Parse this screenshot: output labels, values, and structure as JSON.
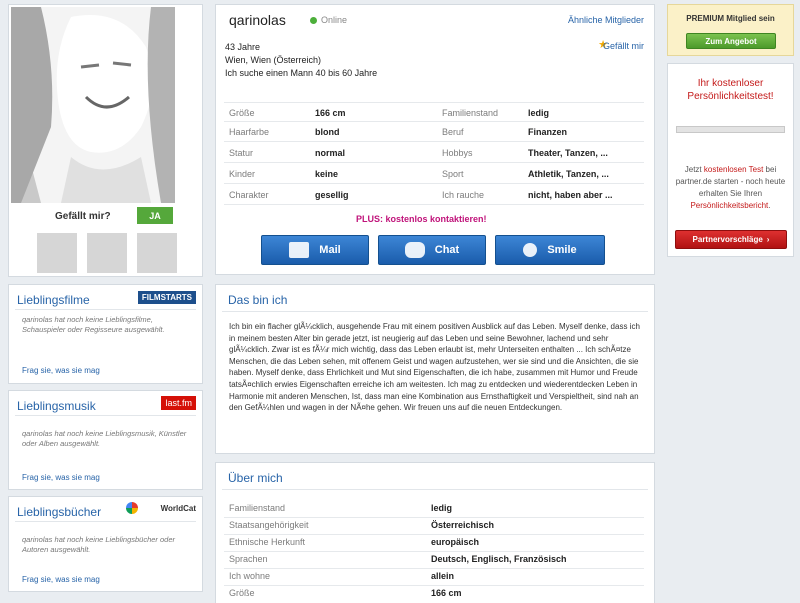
{
  "profile": {
    "username": "qarinolas",
    "status": "Online",
    "similar_link": "Ähnliche Mitglieder",
    "like_link": "Gefällt mir",
    "age": "43 Jahre",
    "location": "Wien, Wien (Österreich)",
    "search": "Ich suche einen Mann 40 bis 60 Jahre",
    "like_question": "Gefällt mir?",
    "like_button": "JA",
    "plus_text": "PLUS: kostenlos kontaktieren!",
    "mail_label": "Mail",
    "chat_label": "Chat",
    "smile_label": "Smile"
  },
  "attributes": [
    {
      "label": "Größe",
      "value": "166 cm",
      "label2": "Familienstand",
      "value2": "ledig"
    },
    {
      "label": "Haarfarbe",
      "value": "blond",
      "label2": "Beruf",
      "value2": "Finanzen"
    },
    {
      "label": "Statur",
      "value": "normal",
      "label2": "Hobbys",
      "value2": "Theater, Tanzen, ..."
    },
    {
      "label": "Kinder",
      "value": "keine",
      "label2": "Sport",
      "value2": "Athletik, Tanzen, ..."
    },
    {
      "label": "Charakter",
      "value": "gesellig",
      "label2": "Ich rauche",
      "value2": "nicht, haben aber ..."
    }
  ],
  "sidebar": {
    "films": {
      "title": "Lieblingsfilme",
      "badge": "FILMSTARTS",
      "text": "qarinolas hat noch keine Lieblingsfilme, Schauspieler oder Regisseure ausgewählt.",
      "link": "Frag sie, was sie mag"
    },
    "music": {
      "title": "Lieblingsmusik",
      "badge": "last.fm",
      "text": "qarinolas hat noch keine Lieblingsmusik, Künstler oder Alben ausgewählt.",
      "link": "Frag sie, was sie mag"
    },
    "books": {
      "title": "Lieblingsbücher",
      "badge": "WorldCat",
      "text": "qarinolas hat noch keine Lieblingsbücher oder Autoren ausgewählt.",
      "link": "Frag sie, was sie mag"
    }
  },
  "about": {
    "title": "Das bin ich",
    "text": "Ich bin ein flacher glÃ¼cklich, ausgehende Frau mit einem positiven Ausblick auf das Leben. Myself denke, dass ich in meinem besten Alter bin gerade jetzt, ist neugierig auf das Leben und seine Bewohner, lachend und sehr glÃ¼cklich. Zwar ist es fÃ¼r mich wichtig, dass das Leben erlaubt ist, mehr Unterseiten enthalten ... Ich schÃ¤tze Menschen, die das Leben sehen, mit offenem Geist und wagen aufzustehen, wer sie sind und die Ansichten, die sie haben. Myself denke, dass Ehrlichkeit und Mut sind Eigenschaften, die ich habe, zusammen mit Humor und Freude tatsÃ¤chlich erwies Eigenschaften erreiche ich am weitesten. Ich mag zu entdecken und wiederentdecken Leben in Harmonie mit anderen Menschen, Ist, dass man eine Kombination aus Ernsthaftigkeit und Verspieltheit, sind nah an den GefÃ¼hlen und wagen in der NÃ¤he gehen. Wir freuen uns auf die neuen Entdeckungen."
  },
  "details": {
    "title": "Über mich",
    "rows": [
      {
        "label": "Familienstand",
        "value": "ledig"
      },
      {
        "label": "Staatsangehörigkeit",
        "value": "Österreichisch"
      },
      {
        "label": "Ethnische Herkunft",
        "value": "europäisch"
      },
      {
        "label": "Sprachen",
        "value": "Deutsch, Englisch, Französisch"
      },
      {
        "label": "Ich wohne",
        "value": "allein"
      },
      {
        "label": "Größe",
        "value": "166 cm"
      }
    ]
  },
  "right": {
    "premium_text": "PREMIUM Mitglied sein",
    "offer_button": "Zum Angebot",
    "test_title": "Ihr kostenloser Persönlichkeitstest!",
    "test_text_1": "Jetzt ",
    "test_text_link": "kostenlosen Test",
    "test_text_2": " bei partner.de starten - noch heute erhalten Sie Ihren ",
    "test_text_link2": "Persönlichkeitsbericht",
    "test_text_3": ".",
    "partner_button": "Partnervorschläge"
  },
  "colors": {
    "accent_blue": "#2864a8",
    "online_green": "#4caf3a",
    "premium_yellow": "#fbf1c8",
    "partner_red": "#c41a1a",
    "plus_magenta": "#c0137a"
  }
}
